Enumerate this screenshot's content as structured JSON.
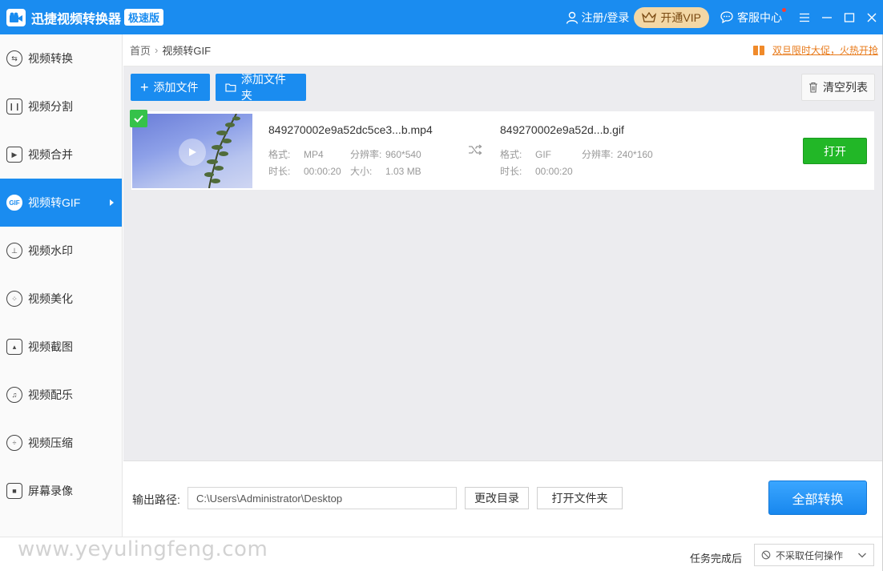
{
  "app": {
    "title": "迅捷视频转换器",
    "edition": "极速版",
    "logo_icon": "camera-logo-icon"
  },
  "header": {
    "login_label": "注册/登录",
    "vip_label": "开通VIP",
    "service_label": "客服中心",
    "colors": {
      "title_bar": "#1a8cf0",
      "vip_bg": "#f3d7a5"
    }
  },
  "sidebar": {
    "active_index": 3,
    "items": [
      {
        "label": "视频转换",
        "icon": "convert-icon"
      },
      {
        "label": "视频分割",
        "icon": "split-icon"
      },
      {
        "label": "视频合并",
        "icon": "merge-icon"
      },
      {
        "label": "视频转GIF",
        "icon": "gif-icon",
        "icon_text": "GIF"
      },
      {
        "label": "视频水印",
        "icon": "watermark-icon"
      },
      {
        "label": "视频美化",
        "icon": "beautify-icon"
      },
      {
        "label": "视频截图",
        "icon": "screenshot-icon"
      },
      {
        "label": "视频配乐",
        "icon": "music-icon"
      },
      {
        "label": "视频压缩",
        "icon": "compress-icon"
      },
      {
        "label": "屏幕录像",
        "icon": "record-icon"
      }
    ]
  },
  "breadcrumb": {
    "home": "首页",
    "separator": "›",
    "current": "视频转GIF"
  },
  "promo": {
    "text": "双旦限时大促，火热开抢"
  },
  "toolbar": {
    "add_file": "添加文件",
    "add_folder": "添加文件夹",
    "clear_list": "清空列表"
  },
  "file": {
    "source": {
      "name": "849270002e9a52dc5ce3...b.mp4",
      "format_label": "格式:",
      "format": "MP4",
      "resolution_label": "分辨率:",
      "resolution": "960*540",
      "duration_label": "时长:",
      "duration": "00:00:20",
      "size_label": "大小:",
      "size": "1.03 MB"
    },
    "output": {
      "name": "849270002e9a52d...b.gif",
      "format_label": "格式:",
      "format": "GIF",
      "resolution_label": "分辨率:",
      "resolution": "240*160",
      "duration_label": "时长:",
      "duration": "00:00:20"
    },
    "open_label": "打开",
    "checked": true
  },
  "output_bar": {
    "label": "输出路径:",
    "path": "C:\\Users\\Administrator\\Desktop",
    "change_dir": "更改目录",
    "open_folder": "打开文件夹",
    "convert_all": "全部转换"
  },
  "statusbar": {
    "watermark": "www.yeyulingfeng.com",
    "after_task_label": "任务完成后",
    "after_task_value": "不采取任何操作"
  }
}
